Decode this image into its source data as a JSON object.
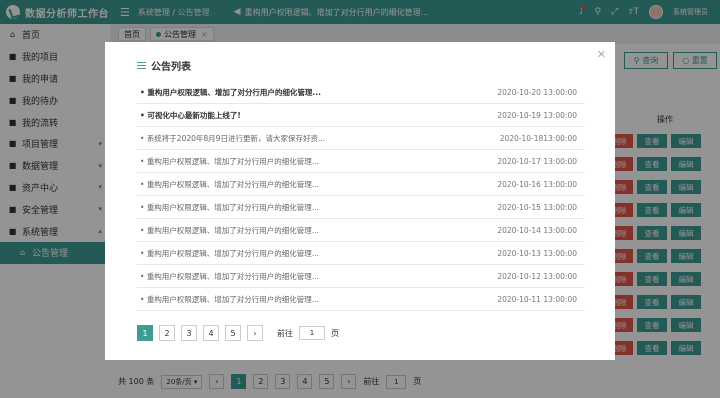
{
  "app": {
    "title": "数据分析师工作台"
  },
  "topbar": {
    "menu_icon": "menu-fold-icon",
    "breadcrumb_parent": "系统管理",
    "breadcrumb_sep": " / ",
    "breadcrumb_current": "公告管理",
    "notice": "重构用户权限逻辑、增加了对分行用户的细化管理...",
    "user_name": "系统管理员",
    "font_icon": "тT",
    "colors": {
      "primary": "#3f9b94",
      "danger": "#e0574a"
    }
  },
  "sidebar": {
    "items": [
      {
        "label": "首页",
        "icon": "home-icon"
      },
      {
        "label": "我的项目",
        "icon": "cube-icon"
      },
      {
        "label": "我的申请",
        "icon": "cube-icon"
      },
      {
        "label": "我的待办",
        "icon": "cube-icon"
      },
      {
        "label": "我的流转",
        "icon": "cube-icon"
      },
      {
        "label": "项目管理",
        "icon": "cube-icon"
      },
      {
        "label": "数据管理",
        "icon": "cube-icon"
      },
      {
        "label": "资产中心",
        "icon": "cube-icon"
      },
      {
        "label": "安全管理",
        "icon": "cube-icon"
      },
      {
        "label": "系统管理",
        "icon": "cube-icon"
      },
      {
        "label": "公告管理",
        "icon": "bank-icon"
      }
    ]
  },
  "tabs": [
    {
      "label": "首页"
    },
    {
      "label": "公告管理"
    }
  ],
  "main": {
    "search_label": "查询",
    "reset_label": "重置",
    "op_header": "操作",
    "delete_label": "删除",
    "view_label": "查看",
    "edit_label": "编辑",
    "total_label": "共 100 条",
    "page_size": "20条/页",
    "pages": [
      "1",
      "2",
      "3",
      "4",
      "5"
    ],
    "goto_prefix": "前往",
    "goto_value": "1",
    "goto_suffix": "页"
  },
  "modal": {
    "title": "公告列表",
    "items": [
      {
        "title": "重构用户权限逻辑、增加了对分行用户的细化管理...",
        "date": "2020-10-20 13:00:00"
      },
      {
        "title": "可视化中心最新功能上线了!",
        "date": "2020-10-19 13:00:00"
      },
      {
        "title": "系统将于2020年8月9日进行更新，请大家保存好资...",
        "date": "2020-10-1813:00:00"
      },
      {
        "title": "重构用户权限逻辑、增加了对分行用户的细化管理...",
        "date": "2020-10-17 13:00:00"
      },
      {
        "title": "重构用户权限逻辑、增加了对分行用户的细化管理...",
        "date": "2020-10-16 13:00:00"
      },
      {
        "title": "重构用户权限逻辑、增加了对分行用户的细化管理...",
        "date": "2020-10-15 13:00:00"
      },
      {
        "title": "重构用户权限逻辑、增加了对分行用户的细化管理...",
        "date": "2020-10-14 13:00:00"
      },
      {
        "title": "重构用户权限逻辑、增加了对分行用户的细化管理...",
        "date": "2020-10-13 13:00:00"
      },
      {
        "title": "重构用户权限逻辑、增加了对分行用户的细化管理...",
        "date": "2020-10-12 13:00:00"
      },
      {
        "title": "重构用户权限逻辑、增加了对分行用户的细化管理...",
        "date": "2020-10-11 13:00:00"
      }
    ],
    "pages": [
      "1",
      "2",
      "3",
      "4",
      "5"
    ],
    "goto_prefix": "前往",
    "goto_value": "1",
    "goto_suffix": "页"
  }
}
